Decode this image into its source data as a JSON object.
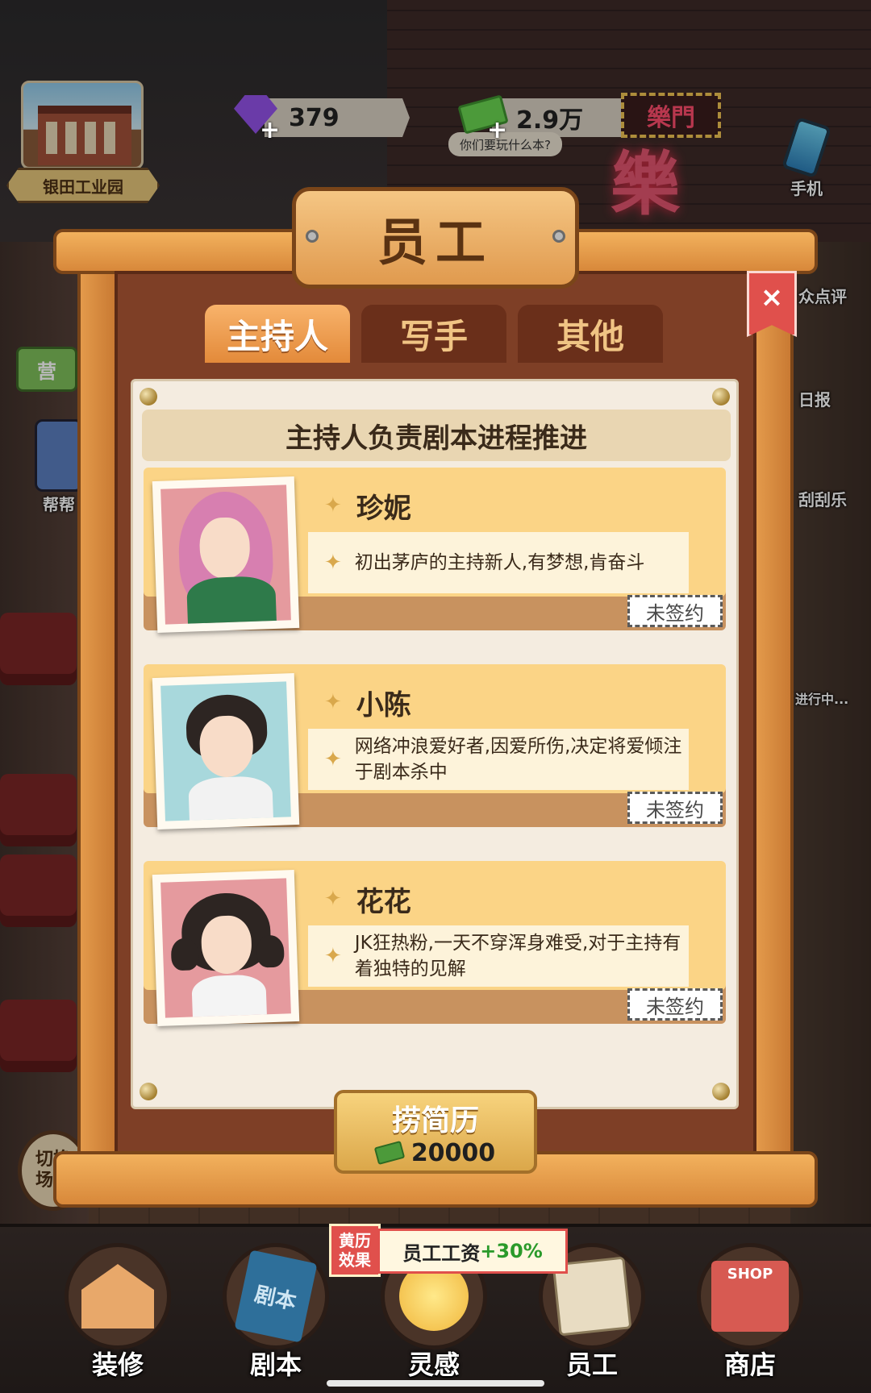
{
  "hud": {
    "location": "银田工业园",
    "gems": "379",
    "cash": "2.9万",
    "cash_bubble": "你们要玩什么本?",
    "phone_label": "手机",
    "neon_sign": "樂門",
    "neon_big": "樂"
  },
  "side_labels": {
    "review": "众点评",
    "daily": "日报",
    "scratch": "刮刮乐",
    "in_progress": "进行中...",
    "help": "帮帮",
    "switch": "切换\n场景"
  },
  "panel": {
    "title": "员工",
    "close_label": "×",
    "tabs": [
      {
        "label": "主持人",
        "active": true
      },
      {
        "label": "写手",
        "active": false
      },
      {
        "label": "其他",
        "active": false
      }
    ],
    "subtitle": "主持人负责剧本进程推进",
    "staff": [
      {
        "name": "珍妮",
        "description": "初出茅庐的主持新人,有梦想,肯奋斗",
        "status": "未签约",
        "portrait": "pink-hair-girl-portrait"
      },
      {
        "name": "小陈",
        "description": "网络冲浪爱好者,因爱所伤,决定将爱倾注于剧本杀中",
        "status": "未签约",
        "portrait": "dark-hair-boy-portrait"
      },
      {
        "name": "花花",
        "description": "JK狂热粉,一天不穿浑身难受,对于主持有着独特的见解",
        "status": "未签约",
        "portrait": "pigtail-girl-portrait"
      }
    ],
    "resume_button": {
      "label": "捞简历",
      "cost": "20000"
    }
  },
  "buff": {
    "tag": "黄历\n效果",
    "text": "员工工资",
    "value": "+30%"
  },
  "nav": [
    {
      "label": "装修",
      "icon": "house-icon"
    },
    {
      "label": "剧本",
      "icon": "book-icon",
      "icon_text": "剧本"
    },
    {
      "label": "灵感",
      "icon": "bulb-icon"
    },
    {
      "label": "员工",
      "icon": "badge-icon"
    },
    {
      "label": "商店",
      "icon": "shop-icon",
      "icon_text": "SHOP"
    }
  ],
  "colors": {
    "accent_orange": "#e38a3a",
    "card_yellow": "#fbd486",
    "close_red": "#e0504c",
    "buff_green": "#2a9a2a"
  }
}
